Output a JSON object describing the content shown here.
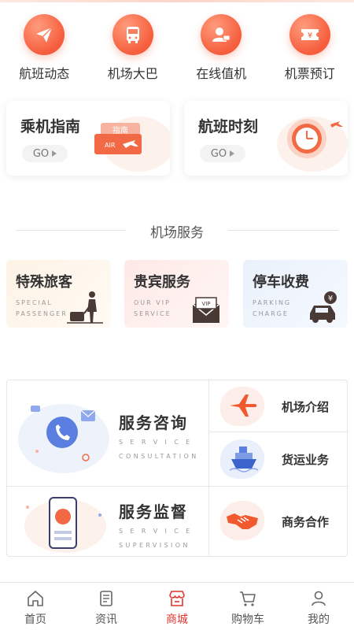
{
  "quick_menu": [
    {
      "label": "航班动态",
      "icon": "paper-plane-icon"
    },
    {
      "label": "机场大巴",
      "icon": "bus-icon"
    },
    {
      "label": "在线值机",
      "icon": "person-checkin-icon"
    },
    {
      "label": "机票预订",
      "icon": "ticket-yen-icon"
    }
  ],
  "guide_cards": [
    {
      "title": "乘机指南",
      "button": "GO",
      "tag": "指南",
      "badge": "AIR"
    },
    {
      "title": "航班时刻",
      "button": "GO"
    }
  ],
  "section_title": "机场服务",
  "services": [
    {
      "title": "特殊旅客",
      "subtitle_1": "SPECIAL",
      "subtitle_2": "PASSENGER",
      "icon": "traveler-luggage-icon"
    },
    {
      "title": "贵宾服务",
      "subtitle_1": "OUR VIP",
      "subtitle_2": "SERVICE",
      "icon": "vip-envelope-icon",
      "icon_text": "VIP"
    },
    {
      "title": "停车收费",
      "subtitle_1": "PARKING",
      "subtitle_2": "CHARGE",
      "icon": "car-yen-icon",
      "icon_text": "¥"
    }
  ],
  "grid": {
    "consult": {
      "title": "服务咨询",
      "sub_1": "S E R V I C E",
      "sub_2": "CONSULTATION"
    },
    "supervise": {
      "title": "服务监督",
      "sub_1": "S E R V I C E",
      "sub_2": "SUPERVISION"
    },
    "items": [
      {
        "label": "机场介绍",
        "icon": "airplane-icon"
      },
      {
        "label": "货运业务",
        "icon": "cargo-ship-icon"
      },
      {
        "label": "商务合作",
        "icon": "handshake-icon"
      }
    ]
  },
  "tabs": [
    {
      "label": "首页",
      "icon": "home-icon",
      "active": false
    },
    {
      "label": "资讯",
      "icon": "news-icon",
      "active": false
    },
    {
      "label": "商城",
      "icon": "store-icon",
      "active": true
    },
    {
      "label": "购物车",
      "icon": "cart-icon",
      "active": false
    },
    {
      "label": "我的",
      "icon": "profile-icon",
      "active": false
    }
  ],
  "colors": {
    "accent": "#f55d3c",
    "active_tab": "#e0352f",
    "service_1": "#fdf3e6",
    "service_2": "#fde9e6",
    "service_3": "#eaf1fb"
  }
}
